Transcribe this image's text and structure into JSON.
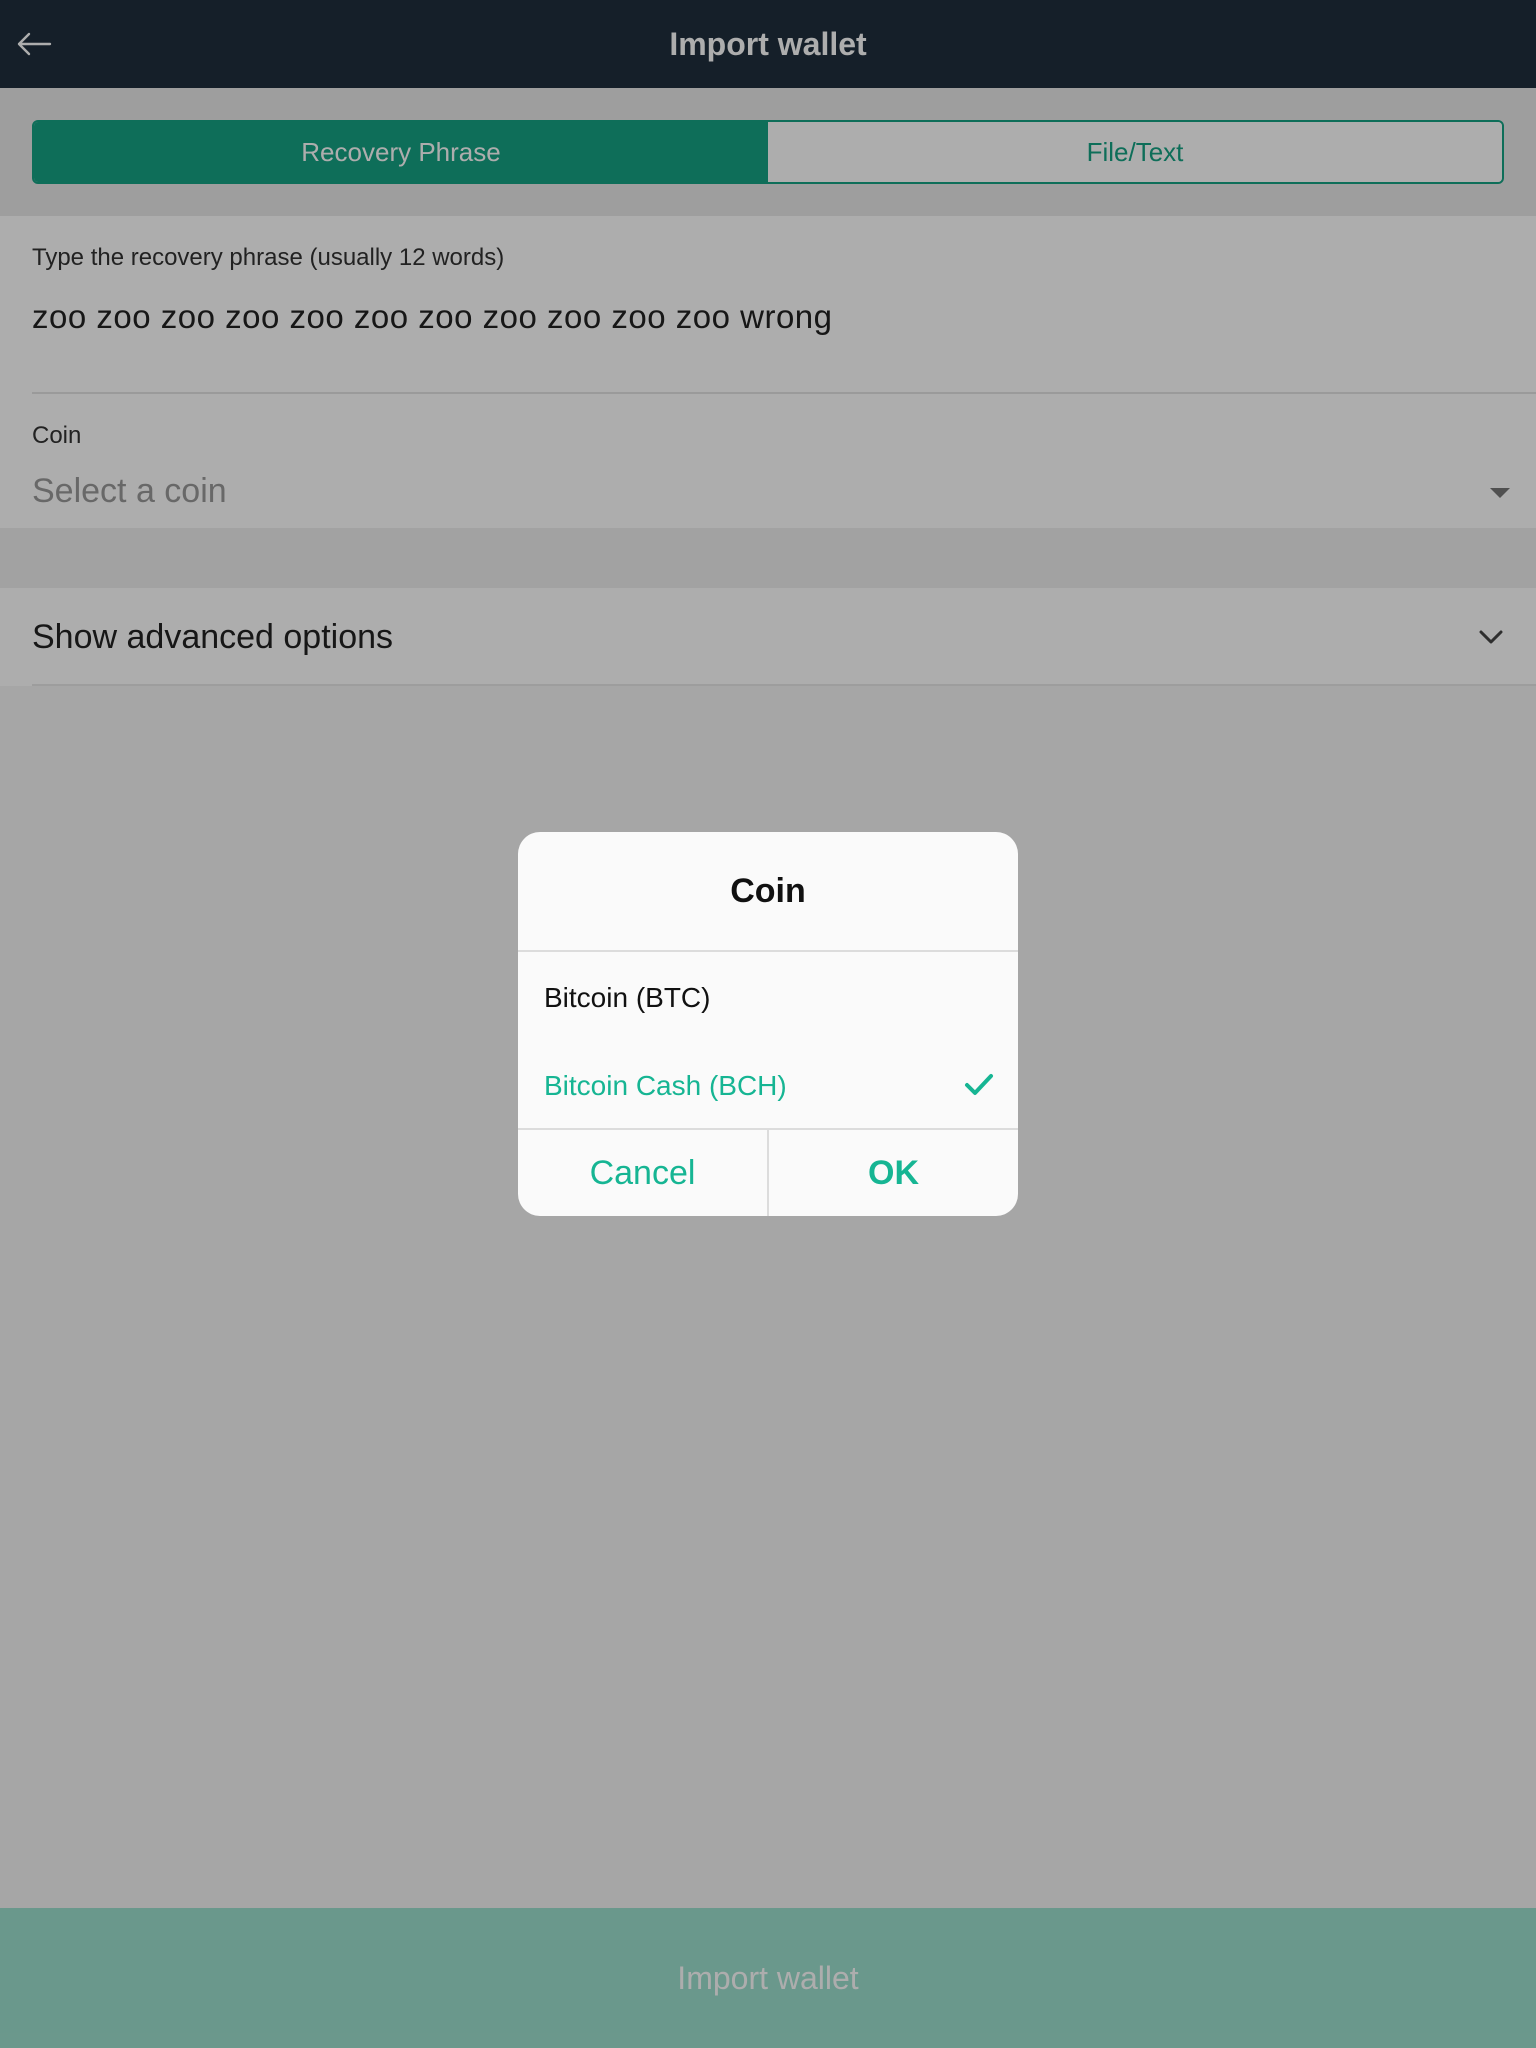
{
  "header": {
    "title": "Import wallet",
    "back_icon": "arrow-left-icon"
  },
  "tabs": [
    {
      "label": "Recovery Phrase",
      "active": true
    },
    {
      "label": "File/Text",
      "active": false
    }
  ],
  "form": {
    "phrase_label": "Type the recovery phrase (usually 12 words)",
    "phrase_value": "zoo zoo zoo zoo zoo zoo zoo zoo zoo zoo zoo wrong",
    "coin_label": "Coin",
    "coin_placeholder": "Select a coin",
    "advanced_label": "Show advanced options"
  },
  "footer": {
    "import_label": "Import wallet"
  },
  "dialog": {
    "title": "Coin",
    "options": [
      {
        "label": "Bitcoin (BTC)",
        "selected": false
      },
      {
        "label": "Bitcoin Cash (BCH)",
        "selected": true
      }
    ],
    "cancel_label": "Cancel",
    "ok_label": "OK"
  },
  "colors": {
    "accent": "#16a383",
    "topbar": "#1f2f3d",
    "dialog_accent": "#16b593"
  }
}
